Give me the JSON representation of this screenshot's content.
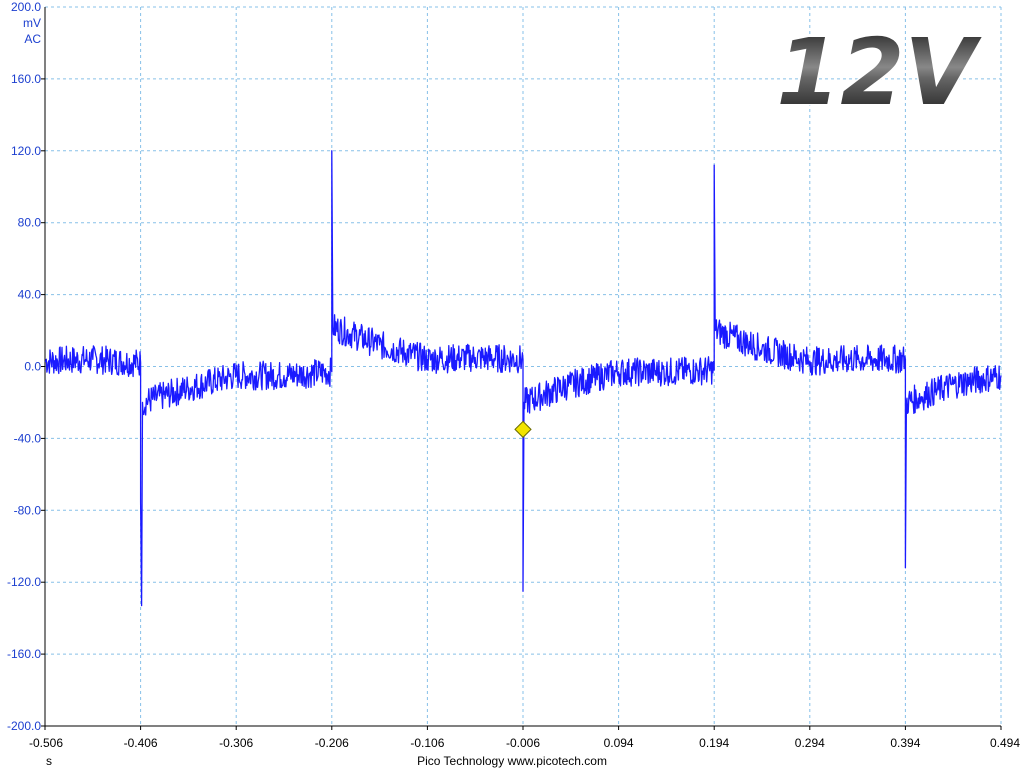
{
  "chart_data": {
    "type": "line",
    "title": "",
    "ylabel_lines": [
      "200.0",
      "mV",
      "AC"
    ],
    "xlabel": "s",
    "footer": "Pico Technology  www.picotech.com",
    "badge": "12V",
    "xlim": [
      -0.506,
      0.494
    ],
    "ylim": [
      -200,
      200
    ],
    "x_ticks": [
      "-0.506",
      "-0.406",
      "-0.306",
      "-0.206",
      "-0.106",
      "-0.006",
      "0.094",
      "0.194",
      "0.294",
      "0.394",
      "0.494"
    ],
    "y_ticks": [
      "160.0",
      "120.0",
      "80.0",
      "40.0",
      "0.0",
      "-40.0",
      "-80.0",
      "-120.0",
      "-160.0",
      "-200.0"
    ],
    "y_tick_values": [
      160,
      120,
      80,
      40,
      0,
      -40,
      -80,
      -120,
      -160,
      -200
    ],
    "grid": true,
    "trigger_marker": {
      "x": -0.006,
      "y": -35
    },
    "series": [
      {
        "name": "",
        "color": "#1a1aff",
        "points": [
          [
            -0.506,
            3
          ],
          [
            -0.456,
            4
          ],
          [
            -0.406,
            2
          ],
          [
            -0.406,
            -75
          ],
          [
            -0.405,
            -133
          ],
          [
            -0.404,
            -20
          ],
          [
            -0.356,
            -12
          ],
          [
            -0.306,
            -5
          ],
          [
            -0.256,
            -5
          ],
          [
            -0.206,
            -3
          ],
          [
            -0.206,
            120
          ],
          [
            -0.205,
            22
          ],
          [
            -0.156,
            12
          ],
          [
            -0.106,
            4
          ],
          [
            -0.056,
            5
          ],
          [
            -0.006,
            4
          ],
          [
            -0.006,
            -125
          ],
          [
            -0.005,
            -20
          ],
          [
            0.044,
            -10
          ],
          [
            0.094,
            -3
          ],
          [
            0.144,
            -3
          ],
          [
            0.194,
            -2
          ],
          [
            0.194,
            112
          ],
          [
            0.195,
            20
          ],
          [
            0.244,
            10
          ],
          [
            0.294,
            3
          ],
          [
            0.344,
            4
          ],
          [
            0.394,
            4
          ],
          [
            0.394,
            -112
          ],
          [
            0.395,
            -20
          ],
          [
            0.444,
            -10
          ],
          [
            0.494,
            -5
          ]
        ],
        "noise_band": 8
      }
    ]
  }
}
